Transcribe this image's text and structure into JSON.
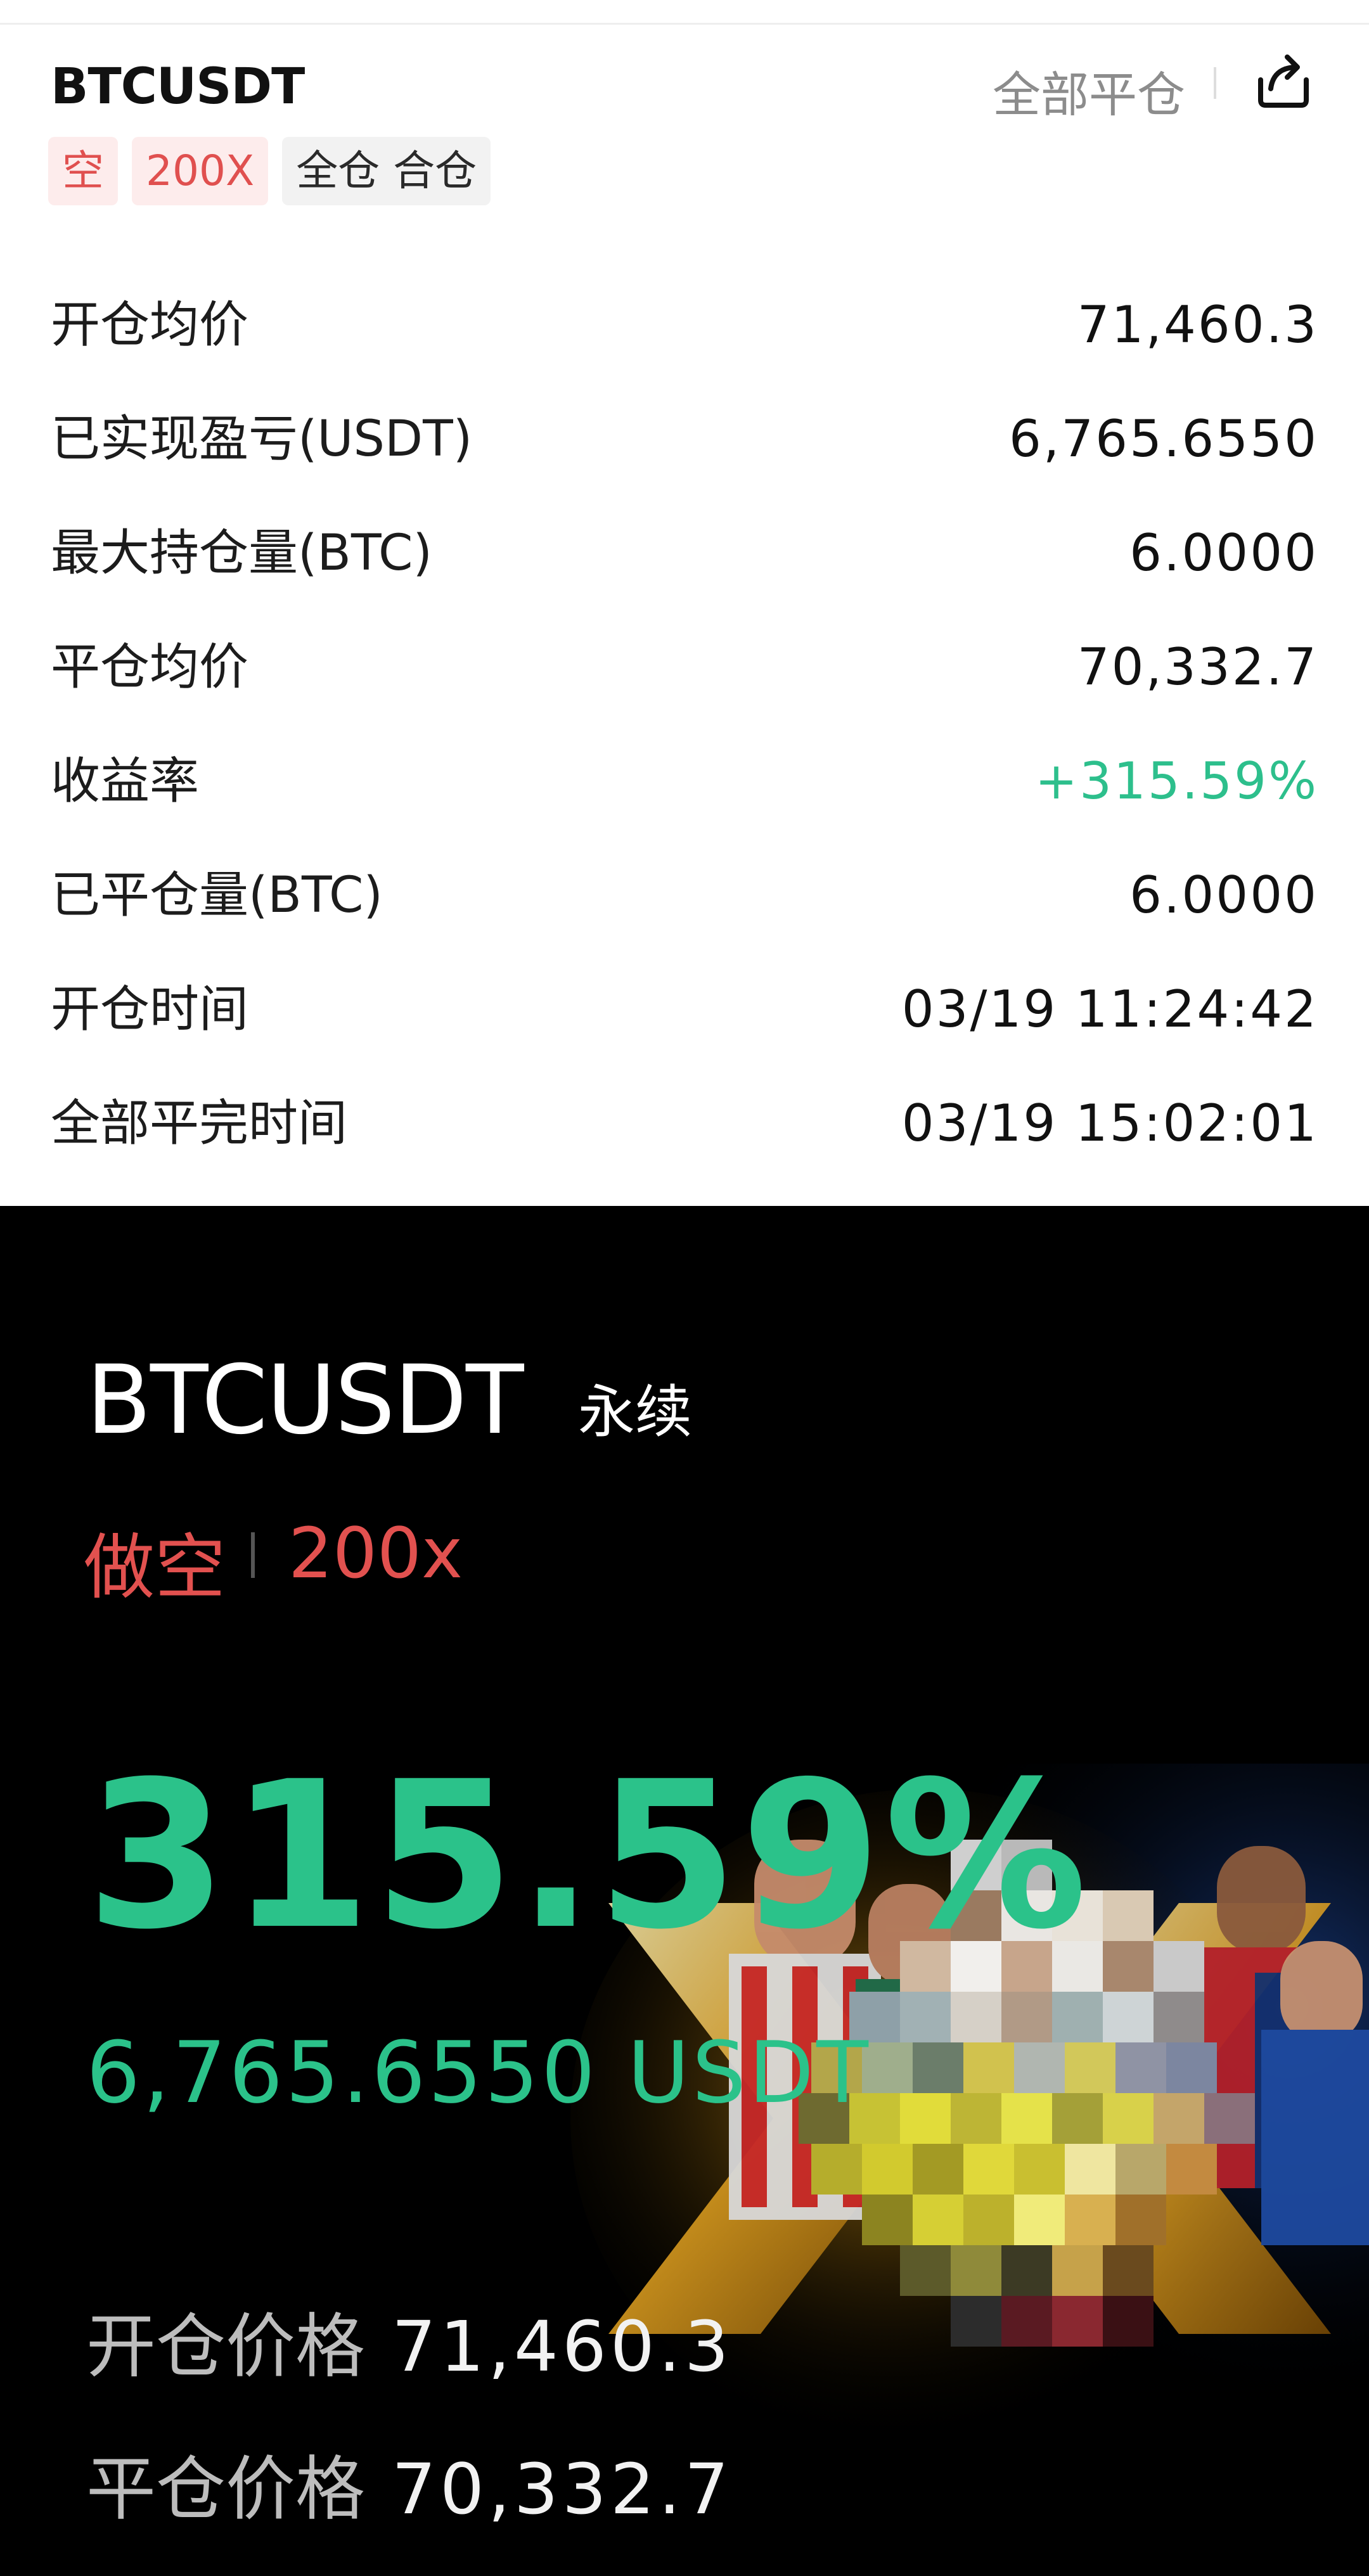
{
  "header": {
    "symbol": "BTCUSDT",
    "close_all": "全部平仓",
    "share_icon": "share-icon"
  },
  "tags": [
    "空",
    "200X",
    "全仓 合仓"
  ],
  "details": [
    {
      "label": "开仓均价",
      "value": "71,460.3"
    },
    {
      "label": "已实现盈亏(USDT)",
      "value": "6,765.6550"
    },
    {
      "label": "最大持仓量(BTC)",
      "value": "6.0000"
    },
    {
      "label": "平仓均价",
      "value": "70,332.7"
    },
    {
      "label": "收益率",
      "value": "+315.59%"
    },
    {
      "label": "已平仓量(BTC)",
      "value": "6.0000"
    },
    {
      "label": "开仓时间",
      "value": "03/19 11:24:42"
    },
    {
      "label": "全部平完时间",
      "value": "03/19 15:02:01"
    }
  ],
  "poster": {
    "symbol": "BTCUSDT",
    "contract_type": "永续",
    "direction": "做空",
    "leverage": "200x",
    "roi": "315.59%",
    "pnl": "6,765.6550 USDT",
    "open_price_label": "开仓价格",
    "open_price": "71,460.3",
    "close_price_label": "平仓价格",
    "close_price": "70,332.7"
  },
  "colors": {
    "profit_green": "#2bc28a",
    "short_red": "#e2514f",
    "tag_red_bg": "#fdecec",
    "poster_bg": "#000000"
  }
}
